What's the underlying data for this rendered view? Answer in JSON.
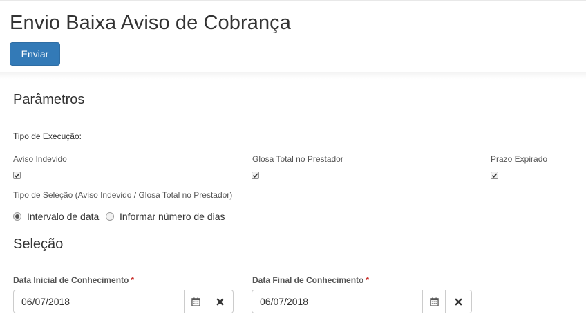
{
  "page": {
    "title": "Envio Baixa Aviso de Cobrança",
    "send_button": "Enviar"
  },
  "parametros": {
    "title": "Parâmetros",
    "tipo_execucao_label": "Tipo de Execução:",
    "options": [
      {
        "label": "Aviso Indevido",
        "checked": true
      },
      {
        "label": "Glosa Total no Prestador",
        "checked": true
      },
      {
        "label": "Prazo Expirado",
        "checked": true
      }
    ],
    "tipo_selecao_label": "Tipo de Seleção (Aviso Indevido / Glosa Total no Prestador)",
    "radio_options": [
      {
        "label": "Intervalo de data",
        "selected": true
      },
      {
        "label": "Informar número de dias",
        "selected": false
      }
    ]
  },
  "selecao": {
    "title": "Seleção",
    "data_inicial": {
      "label": "Data Inicial de Conhecimento",
      "required_mark": "*",
      "value": "06/07/2018"
    },
    "data_final": {
      "label": "Data Final de Conhecimento",
      "required_mark": "*",
      "value": "06/07/2018"
    }
  },
  "icons": {
    "calendar": "calendar-icon",
    "clear": "close-icon",
    "check": "check-icon"
  },
  "colors": {
    "primary": "#337ab7",
    "required": "#c9302c"
  }
}
